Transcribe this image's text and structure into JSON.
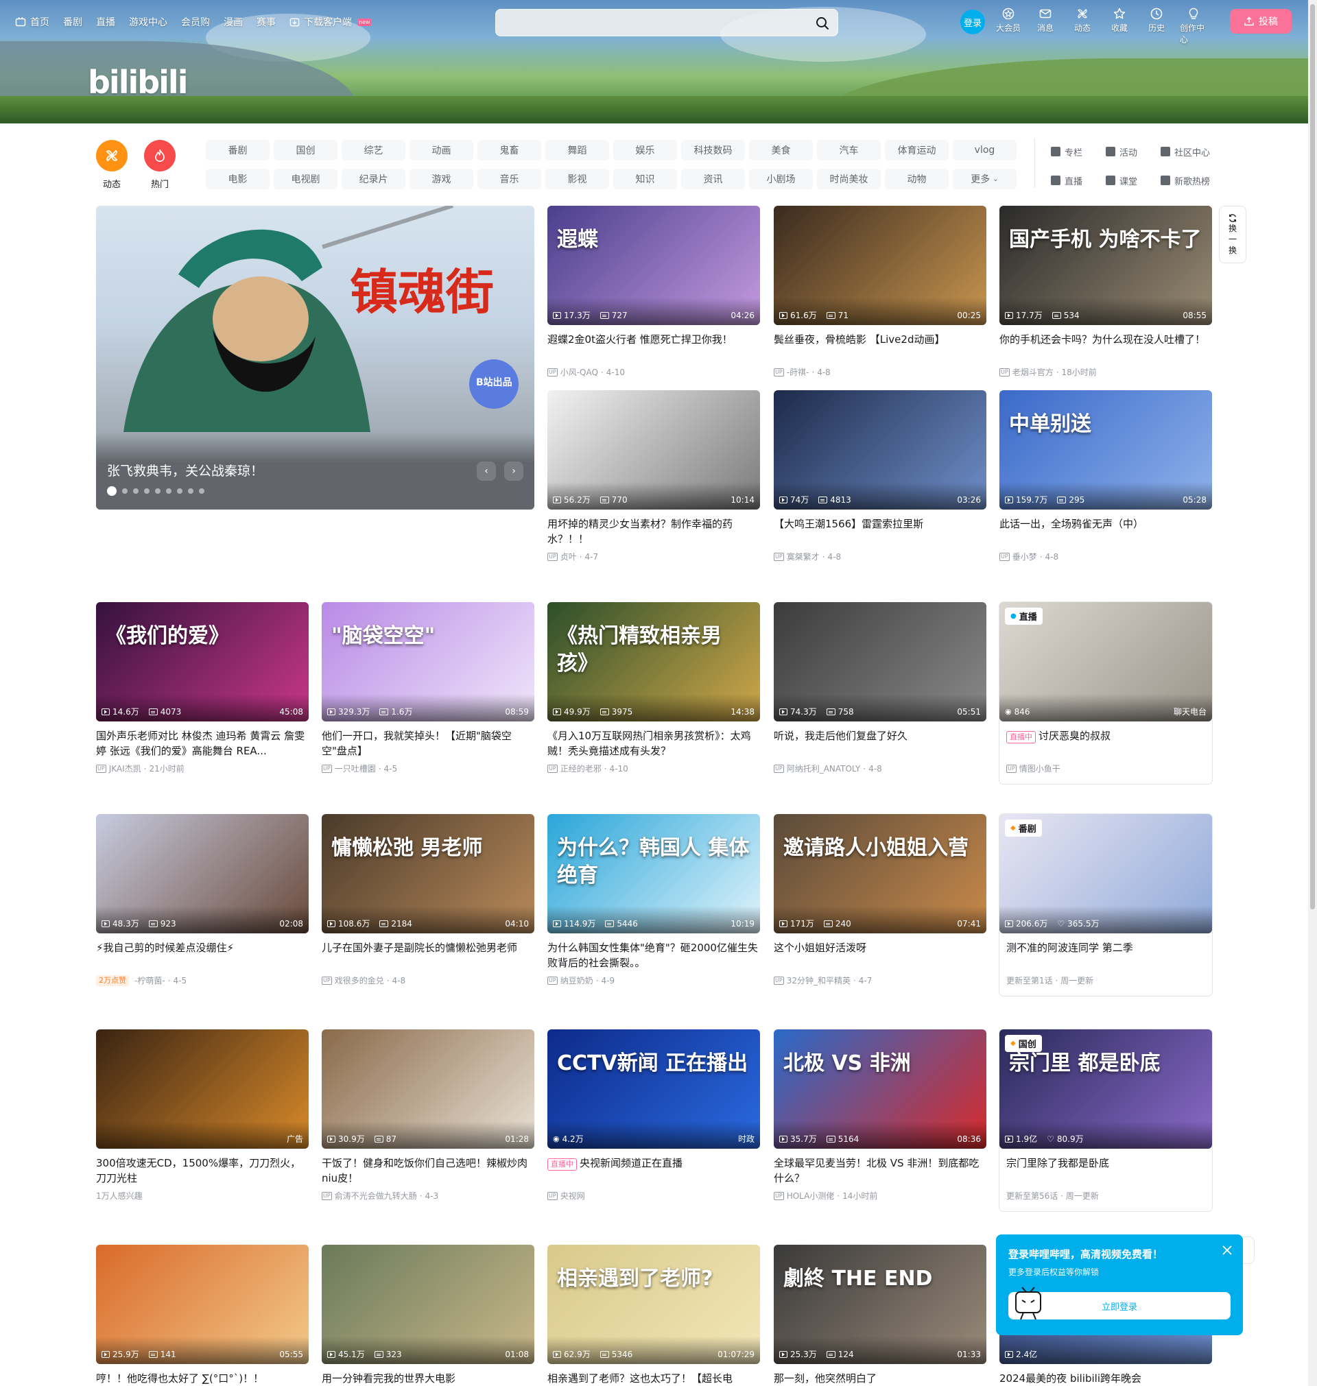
{
  "topnav": {
    "items": [
      "首页",
      "番剧",
      "直播",
      "游戏中心",
      "会员购",
      "漫画",
      "赛事",
      "下载客户端"
    ],
    "new_badge": "new"
  },
  "logo": "bilibili",
  "search": {
    "placeholder": ""
  },
  "rightnav": {
    "login": "登录",
    "items": [
      "大会员",
      "消息",
      "动态",
      "收藏",
      "历史",
      "创作中心"
    ],
    "upload": "投稿"
  },
  "channels": {
    "big": [
      "动态",
      "热门"
    ],
    "grid": [
      "番剧",
      "国创",
      "综艺",
      "动画",
      "鬼畜",
      "舞蹈",
      "娱乐",
      "科技数码",
      "美食",
      "汽车",
      "体育运动",
      "vlog",
      "电影",
      "电视剧",
      "纪录片",
      "游戏",
      "音乐",
      "影视",
      "知识",
      "资讯",
      "小剧场",
      "时尚美妆",
      "动物",
      "更多"
    ],
    "tools": [
      "专栏",
      "活动",
      "社区中心",
      "直播",
      "课堂",
      "新歌热榜"
    ]
  },
  "carousel": {
    "title": "张飞救典韦，关公战秦琼！",
    "art_text": "镇魂街",
    "badge": "B站出品",
    "dots": 9,
    "active": 0
  },
  "refresh": [
    "换",
    "一",
    "换"
  ],
  "cards": [
    {
      "views": "17.3万",
      "danmaku": "727",
      "dur": "04:26",
      "title": "遐蝶2金0t盗火行者 惟愿死亡捍卫你我！",
      "author": "小风-QAQ",
      "date": "4-10",
      "art": "遐蝶",
      "colors": [
        "#4a3f8c",
        "#c59ae0"
      ]
    },
    {
      "views": "61.6万",
      "danmaku": "71",
      "dur": "00:25",
      "title": "鬓丝垂夜，骨梳皓影 【Live2d动画】",
      "author": "-莳祺-",
      "date": "4-8",
      "art": "",
      "colors": [
        "#3a2a1f",
        "#c9964f"
      ]
    },
    {
      "views": "17.7万",
      "danmaku": "534",
      "dur": "08:55",
      "title": "你的手机还会卡吗？为什么现在没人吐槽了！",
      "author": "老烟斗官方",
      "date": "18小时前",
      "art": "国产手机 为啥不卡了",
      "colors": [
        "#2a2a2a",
        "#9a8c74"
      ]
    },
    {
      "views": "56.2万",
      "danmaku": "770",
      "dur": "10:14",
      "title": "用坏掉的精灵少女当素材？制作幸福的药水？！！",
      "author": "贞叶",
      "date": "4-7",
      "art": "",
      "colors": [
        "#f2f2f2",
        "#7a7a7a"
      ]
    },
    {
      "views": "74万",
      "danmaku": "4813",
      "dur": "03:26",
      "title": "【大鸣王潮1566】雷霆索拉里斯",
      "author": "寞桀繁才",
      "date": "4-8",
      "art": "",
      "colors": [
        "#1d2a4a",
        "#6f8fc9"
      ]
    },
    {
      "views": "159.7万",
      "danmaku": "295",
      "dur": "05:28",
      "title": "此话一出，全场鸦雀无声（中）",
      "author": "垂小梦",
      "date": "4-8",
      "art": "中单别送",
      "colors": [
        "#3a69c9",
        "#8fb2ea"
      ]
    },
    {
      "views": "14.6万",
      "danmaku": "4073",
      "dur": "45:08",
      "title": "国外声乐老师对比 林俊杰 迪玛希 黄霄云 詹雯婷 张远《我们的爱》高能舞台 REA...",
      "author": "JKAI杰凯",
      "date": "21小时前",
      "art": "《我们的爱》",
      "colors": [
        "#35123d",
        "#c9378a"
      ]
    },
    {
      "views": "329.3万",
      "danmaku": "1.6万",
      "dur": "08:59",
      "title": "他们一开口，我就笑掉头！【近期\"脑袋空空\"盘点】",
      "author": "一只吐槽園",
      "date": "4-5",
      "art": "\"脑袋空空\"",
      "colors": [
        "#b98ae6",
        "#efe6fa"
      ]
    },
    {
      "views": "49.9万",
      "danmaku": "3975",
      "dur": "14:38",
      "title": "《月入10万互联网热门相亲男孩赏析》：太鸡贼！秃头竟描述成有头发？",
      "author": "正经的老邪",
      "date": "4-10",
      "art": "《热门精致相亲男孩》",
      "colors": [
        "#2c4f2a",
        "#d1a84a"
      ]
    },
    {
      "views": "74.3万",
      "danmaku": "758",
      "dur": "05:51",
      "title": "听说，我走后他们复盘了好久",
      "author": "阿纳托利_ANATOLY",
      "date": "4-8",
      "art": "",
      "colors": [
        "#3b3b3b",
        "#8a8a8a"
      ]
    },
    {
      "live": true,
      "badge": "直播",
      "views": "846",
      "area": "聊天电台",
      "title": "讨厌恶臭的叔叔",
      "live_label": "直播中",
      "author": "情图小鱼干",
      "art": "",
      "colors": [
        "#ddd9d2",
        "#9a948a"
      ]
    },
    {
      "views": "48.3万",
      "danmaku": "923",
      "dur": "02:08",
      "title": "⚡我自己剪的时候差点没绷住⚡",
      "hot": "2万点赞",
      "author": "-柠萌菌-",
      "date": "4-5",
      "art": "",
      "colors": [
        "#c7cbe0",
        "#6a4a3a"
      ]
    },
    {
      "views": "108.6万",
      "danmaku": "2184",
      "dur": "04:10",
      "title": "儿子在国外妻子是副院长的慵懒松弛男老师",
      "author": "戏很多的金兑",
      "date": "4-8",
      "art": "慵懒松弛 男老师",
      "colors": [
        "#4a3a2a",
        "#b98a5a"
      ]
    },
    {
      "views": "114.9万",
      "danmaku": "5446",
      "dur": "10:19",
      "title": "为什么韩国女性集体\"绝育\"？砸2000亿催生失败背后的社会撕裂。。",
      "author": "纳豆奶奶",
      "date": "4-9",
      "art": "为什么？韩国人 集体绝育",
      "colors": [
        "#2aa6d9",
        "#e0f3fb"
      ]
    },
    {
      "views": "171万",
      "danmaku": "240",
      "dur": "07:41",
      "title": "这个小姐姐好活泼呀",
      "author": "32分钟_和平精英",
      "date": "4-7",
      "art": "邀请路人小姐姐入营",
      "colors": [
        "#5a4a3a",
        "#c98a4a"
      ]
    },
    {
      "bangumi": true,
      "badge": "番剧",
      "views": "206.6万",
      "likes": "365.5万",
      "title": "测不准的阿波连同学 第二季",
      "sub": "更新至第1话 · 周一更新",
      "art": "",
      "colors": [
        "#e9e6f2",
        "#8fa9d9"
      ]
    },
    {
      "ad": true,
      "dur": "广告",
      "title": "300倍攻速无CD，1500%爆率，刀刀烈火，刀刀光柱",
      "sub": "1万人感兴趣",
      "art": "",
      "colors": [
        "#3a2412",
        "#d98a2a"
      ]
    },
    {
      "views": "30.9万",
      "danmaku": "87",
      "dur": "01:28",
      "title": "干饭了！健身和吃饭你们自己选吧！辣椒炒肉niu皮！",
      "author": "俞涛不光会做九转大肠",
      "date": "4-3",
      "art": "",
      "colors": [
        "#8a6a4a",
        "#eae2d6"
      ]
    },
    {
      "live": true,
      "views": "4.2万",
      "area": "时政",
      "title": "央视新闻频道正在直播",
      "live_label": "直播中",
      "author": "央视网",
      "art": "CCTV新闻 正在播出",
      "colors": [
        "#0d2a8a",
        "#2a6ae0"
      ]
    },
    {
      "views": "35.7万",
      "danmaku": "5164",
      "dur": "08:36",
      "title": "全球最罕见麦当劳！北极 VS 非洲！到底都吃什么？",
      "author": "HOLA小测佬",
      "date": "14小时前",
      "art": "北极 VS 非洲",
      "colors": [
        "#2a6ac9",
        "#d92a2a"
      ]
    },
    {
      "bangumi": true,
      "badge": "国创",
      "views": "1.9亿",
      "likes": "80.9万",
      "title": "宗门里除了我都是卧底",
      "sub": "更新至第56话 · 周一更新",
      "art": "宗门里 都是卧底",
      "colors": [
        "#2a2a5a",
        "#8a6ac9"
      ]
    },
    {
      "views": "25.9万",
      "danmaku": "141",
      "dur": "05:55",
      "title": "哼！！他吃得也太好了 ∑(°口°`)！！",
      "author": "",
      "date": "",
      "art": "",
      "colors": [
        "#d96a2a",
        "#f2c98a"
      ]
    },
    {
      "views": "45.1万",
      "danmaku": "323",
      "dur": "01:08",
      "title": "用一分钟看完我的世界大电影",
      "author": "",
      "date": "",
      "art": "",
      "colors": [
        "#6a7a5a",
        "#c9b88a"
      ]
    },
    {
      "views": "62.9万",
      "danmaku": "5346",
      "dur": "01:07:29",
      "title": "相亲遇到了老师？这也太巧了！【超长电",
      "author": "",
      "date": "",
      "art": "相亲遇到了老师?",
      "colors": [
        "#d9c98a",
        "#f2e6b8"
      ]
    },
    {
      "views": "25.3万",
      "danmaku": "124",
      "dur": "01:33",
      "title": "那一刻，他突然明白了",
      "author": "",
      "date": "",
      "art": "劇終 THE END",
      "colors": [
        "#3a3a3a",
        "#9a8a7a"
      ]
    },
    {
      "views": "2.4亿",
      "danmaku": "",
      "dur": "",
      "title": "2024最美的夜 bilibili跨年晚会",
      "author": "",
      "date": "",
      "art": "",
      "colors": [
        "#2a3a6a",
        "#6a8ac9"
      ]
    }
  ],
  "popup": {
    "title": "登录哔哩哔哩，高清视频免费看！",
    "sub": "更多登录后权益等你解锁",
    "button": "立即登录"
  },
  "colors": {
    "brand_blue": "#00aeec",
    "brand_pink": "#fb7299",
    "text": "#18191c",
    "muted": "#9499a0"
  }
}
